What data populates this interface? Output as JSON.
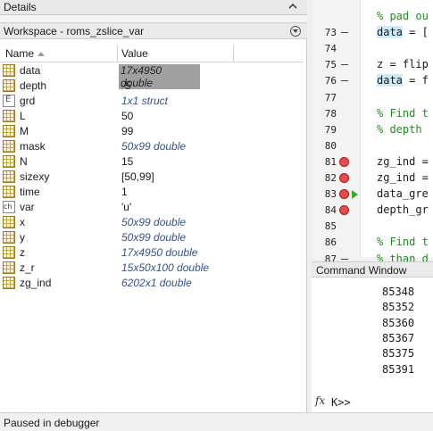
{
  "details": {
    "title": "Details"
  },
  "workspace": {
    "title": "Workspace - roms_zslice_var",
    "columns": {
      "name": "Name",
      "value": "Value"
    },
    "rows": [
      {
        "name": "data",
        "value": "17x4950 double",
        "icon": "matrix-icon",
        "style": "sel"
      },
      {
        "name": "depth",
        "value": "-5",
        "icon": "matrix-icon",
        "style": "plain"
      },
      {
        "name": "grd",
        "value": "1x1 struct",
        "icon": "struct-icon",
        "style": "italic"
      },
      {
        "name": "L",
        "value": "50",
        "icon": "matrix-icon",
        "style": "plain"
      },
      {
        "name": "M",
        "value": "99",
        "icon": "matrix-icon",
        "style": "plain"
      },
      {
        "name": "mask",
        "value": "50x99 double",
        "icon": "matrix-icon",
        "style": "italic"
      },
      {
        "name": "N",
        "value": "15",
        "icon": "matrix-icon",
        "style": "plain"
      },
      {
        "name": "sizexy",
        "value": "[50,99]",
        "icon": "matrix-icon",
        "style": "plain"
      },
      {
        "name": "time",
        "value": "1",
        "icon": "matrix-icon",
        "style": "plain"
      },
      {
        "name": "var",
        "value": "'u'",
        "icon": "char-icon",
        "style": "plain"
      },
      {
        "name": "x",
        "value": "50x99 double",
        "icon": "matrix-icon",
        "style": "italic"
      },
      {
        "name": "y",
        "value": "50x99 double",
        "icon": "matrix-icon",
        "style": "italic"
      },
      {
        "name": "z",
        "value": "17x4950 double",
        "icon": "matrix-icon",
        "style": "italic"
      },
      {
        "name": "z_r",
        "value": "15x50x100 double",
        "icon": "matrix-icon",
        "style": "italic"
      },
      {
        "name": "zg_ind",
        "value": "6202x1 double",
        "icon": "matrix-icon",
        "style": "italic"
      }
    ]
  },
  "editor": {
    "lines": [
      {
        "num": "",
        "marker": "none",
        "text": "% pad ou",
        "kind": "comment"
      },
      {
        "num": "73",
        "marker": "dash",
        "text": "data = [",
        "kind": "code",
        "hl": "data"
      },
      {
        "num": "74",
        "marker": "none",
        "text": "",
        "kind": "code"
      },
      {
        "num": "75",
        "marker": "dash",
        "text": "z = flip",
        "kind": "code"
      },
      {
        "num": "76",
        "marker": "dash",
        "text": "data = f",
        "kind": "code",
        "hl": "data"
      },
      {
        "num": "77",
        "marker": "none",
        "text": "",
        "kind": "code"
      },
      {
        "num": "78",
        "marker": "none",
        "text": "% Find t",
        "kind": "comment"
      },
      {
        "num": "79",
        "marker": "none",
        "text": "% depth",
        "kind": "comment"
      },
      {
        "num": "80",
        "marker": "none",
        "text": "",
        "kind": "code"
      },
      {
        "num": "81",
        "marker": "bp",
        "text": "zg_ind =",
        "kind": "code"
      },
      {
        "num": "82",
        "marker": "bp",
        "text": "zg_ind =",
        "kind": "code"
      },
      {
        "num": "83",
        "marker": "bp-arrow",
        "text": "data_gre",
        "kind": "code"
      },
      {
        "num": "84",
        "marker": "bp",
        "text": "depth_gr",
        "kind": "code"
      },
      {
        "num": "85",
        "marker": "none",
        "text": "",
        "kind": "code"
      },
      {
        "num": "86",
        "marker": "none",
        "text": "% Find t",
        "kind": "comment"
      },
      {
        "num": "87",
        "marker": "dash",
        "text": "% than d",
        "kind": "comment"
      }
    ]
  },
  "command_window": {
    "title": "Command Window",
    "output": [
      "85348",
      "85352",
      "85360",
      "85367",
      "85375",
      "85391"
    ],
    "fx": "fx",
    "prompt": "K>>"
  },
  "status": {
    "text": "Paused in debugger"
  }
}
